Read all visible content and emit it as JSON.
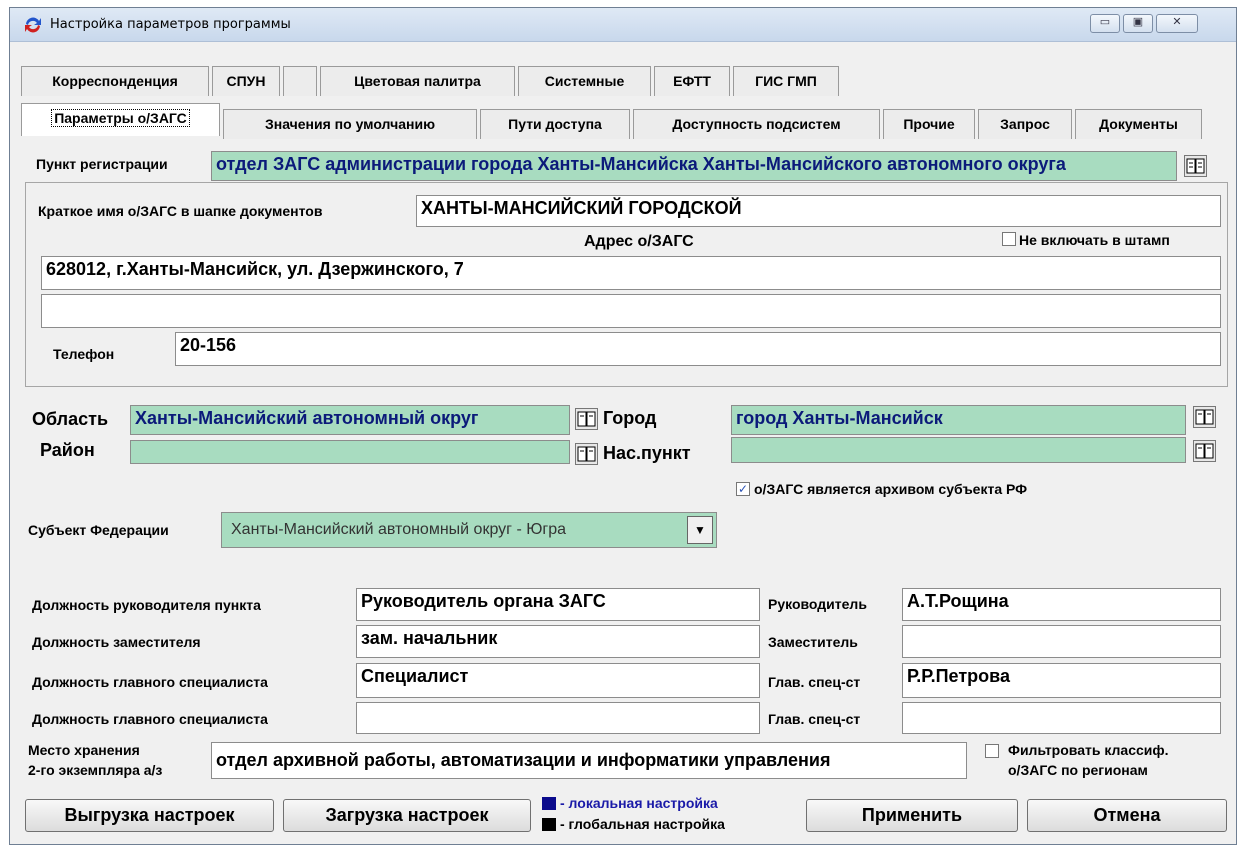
{
  "window": {
    "title": "Настройка параметров программы"
  },
  "tabs_row1": [
    "Корреспонденция",
    "СПУН",
    "",
    "Цветовая палитра",
    "Системные",
    "ЕФТТ",
    "ГИС ГМП"
  ],
  "tabs_row2": [
    "Параметры о/ЗАГС",
    "Значения по умолчанию",
    "Пути доступа",
    "Доступность подсистем",
    "Прочие",
    "Запрос",
    "Документы"
  ],
  "registration": {
    "label": "Пункт регистрации",
    "value": "отдел ЗАГС администрации города Ханты-Мансийска Ханты-Мансийского автономного округа"
  },
  "short_name": {
    "label": "Краткое имя о/ЗАГС в шапке документов",
    "value": "ХАНТЫ-МАНСИЙСКИЙ ГОРОДСКОЙ"
  },
  "address": {
    "label": "Адрес о/ЗАГС",
    "no_stamp_label": "Не включать в штамп",
    "line1": "628012, г.Ханты-Мансийск, ул. Дзержинского, 7",
    "line2": ""
  },
  "phone": {
    "label": "Телефон",
    "value": "20-156"
  },
  "region": {
    "oblast_label": "Область",
    "oblast_value": "Ханты-Мансийский автономный округ",
    "rayon_label": "Район",
    "rayon_value": "",
    "city_label": "Город",
    "city_value": "город Ханты-Мансийск",
    "settlement_label": "Нас.пункт",
    "settlement_value": "",
    "archive_label": "о/ЗАГС является архивом субъекта РФ",
    "archive_checked": true
  },
  "subject": {
    "label": "Субъект Федерации",
    "value": "Ханты-Мансийский автономный округ - Югра"
  },
  "staff": [
    {
      "pos_label": "Должность руководителя пункта",
      "pos_value": "Руководитель органа ЗАГС",
      "name_label": "Руководитель",
      "name_value": "А.Т.Рощина"
    },
    {
      "pos_label": "Должность заместителя",
      "pos_value": "зам. начальник",
      "name_label": "Заместитель",
      "name_value": ""
    },
    {
      "pos_label": "Должность главного специалиста",
      "pos_value": "Специалист",
      "name_label": "Глав. спец-ст",
      "name_value": "Р.Р.Петрова"
    },
    {
      "pos_label": "Должность главного специалиста",
      "pos_value": "",
      "name_label": "Глав. спец-ст",
      "name_value": ""
    }
  ],
  "storage": {
    "label1": "Место хранения",
    "label2": "2-го экземпляра а/з",
    "value": "отдел архивной работы, автоматизации и информатики управления",
    "filter_label1": "Фильтровать классиф.",
    "filter_label2": "о/ЗАГС по регионам"
  },
  "legend": {
    "local": "- локальная настройка",
    "global": "- глобальная настройка",
    "local_color": "#0a0a8c",
    "global_color": "#000000"
  },
  "buttons": {
    "export": "Выгрузка настроек",
    "import": "Загрузка настроек",
    "apply": "Применить",
    "cancel": "Отмена"
  },
  "colors": {
    "green_field": "#a8dcc0",
    "blue_text": "#0b1a7a"
  }
}
